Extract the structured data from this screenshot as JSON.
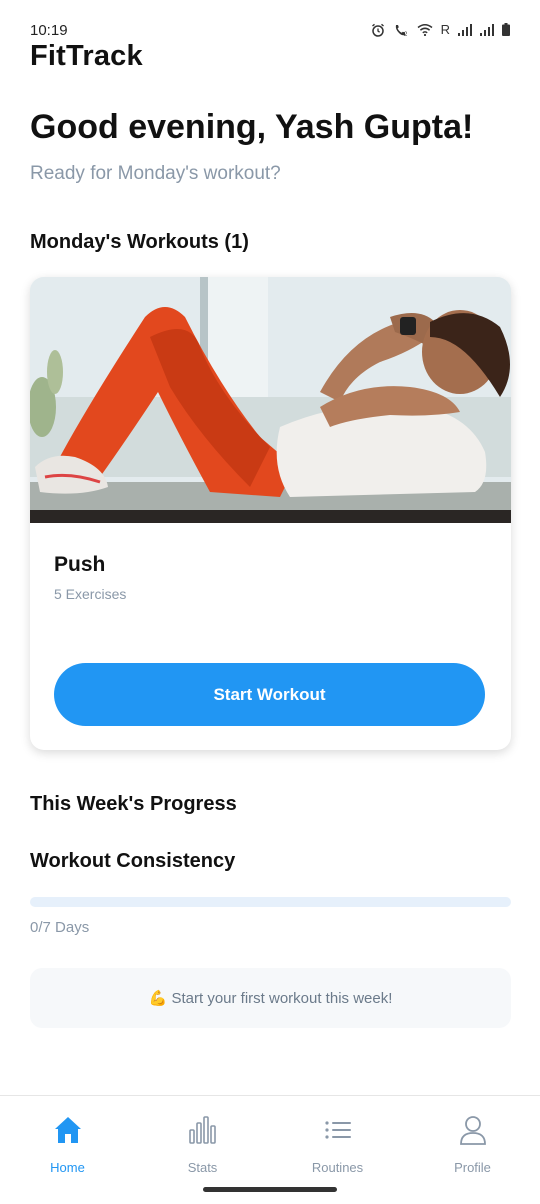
{
  "status_bar": {
    "time": "10:19",
    "roaming": "R",
    "icons": [
      "alarm-icon",
      "wifi-call-icon",
      "wifi-icon",
      "signal-icon",
      "signal-icon",
      "battery-icon"
    ]
  },
  "app": {
    "title": "FitTrack"
  },
  "greeting": {
    "title": "Good evening, Yash Gupta!",
    "subtitle": "Ready for Monday's workout?"
  },
  "workouts": {
    "section_title": "Monday's Workouts (1)",
    "items": [
      {
        "name": "Push",
        "exercises": "5 Exercises",
        "button_label": "Start Workout",
        "image": "woman-doing-crunches-photo"
      }
    ]
  },
  "progress": {
    "section_title": "This Week's Progress",
    "consistency_title": "Workout Consistency",
    "completed": 0,
    "total": 7,
    "days_label": "0/7 Days",
    "motivation": "💪 Start your first workout this week!"
  },
  "nav": {
    "items": [
      {
        "label": "Home",
        "icon": "home-icon",
        "active": true
      },
      {
        "label": "Stats",
        "icon": "bar-chart-icon",
        "active": false
      },
      {
        "label": "Routines",
        "icon": "list-icon",
        "active": false
      },
      {
        "label": "Profile",
        "icon": "person-icon",
        "active": false
      }
    ]
  },
  "colors": {
    "accent": "#2196f3",
    "muted_text": "#8a98a8",
    "track": "#e6f0fb"
  }
}
